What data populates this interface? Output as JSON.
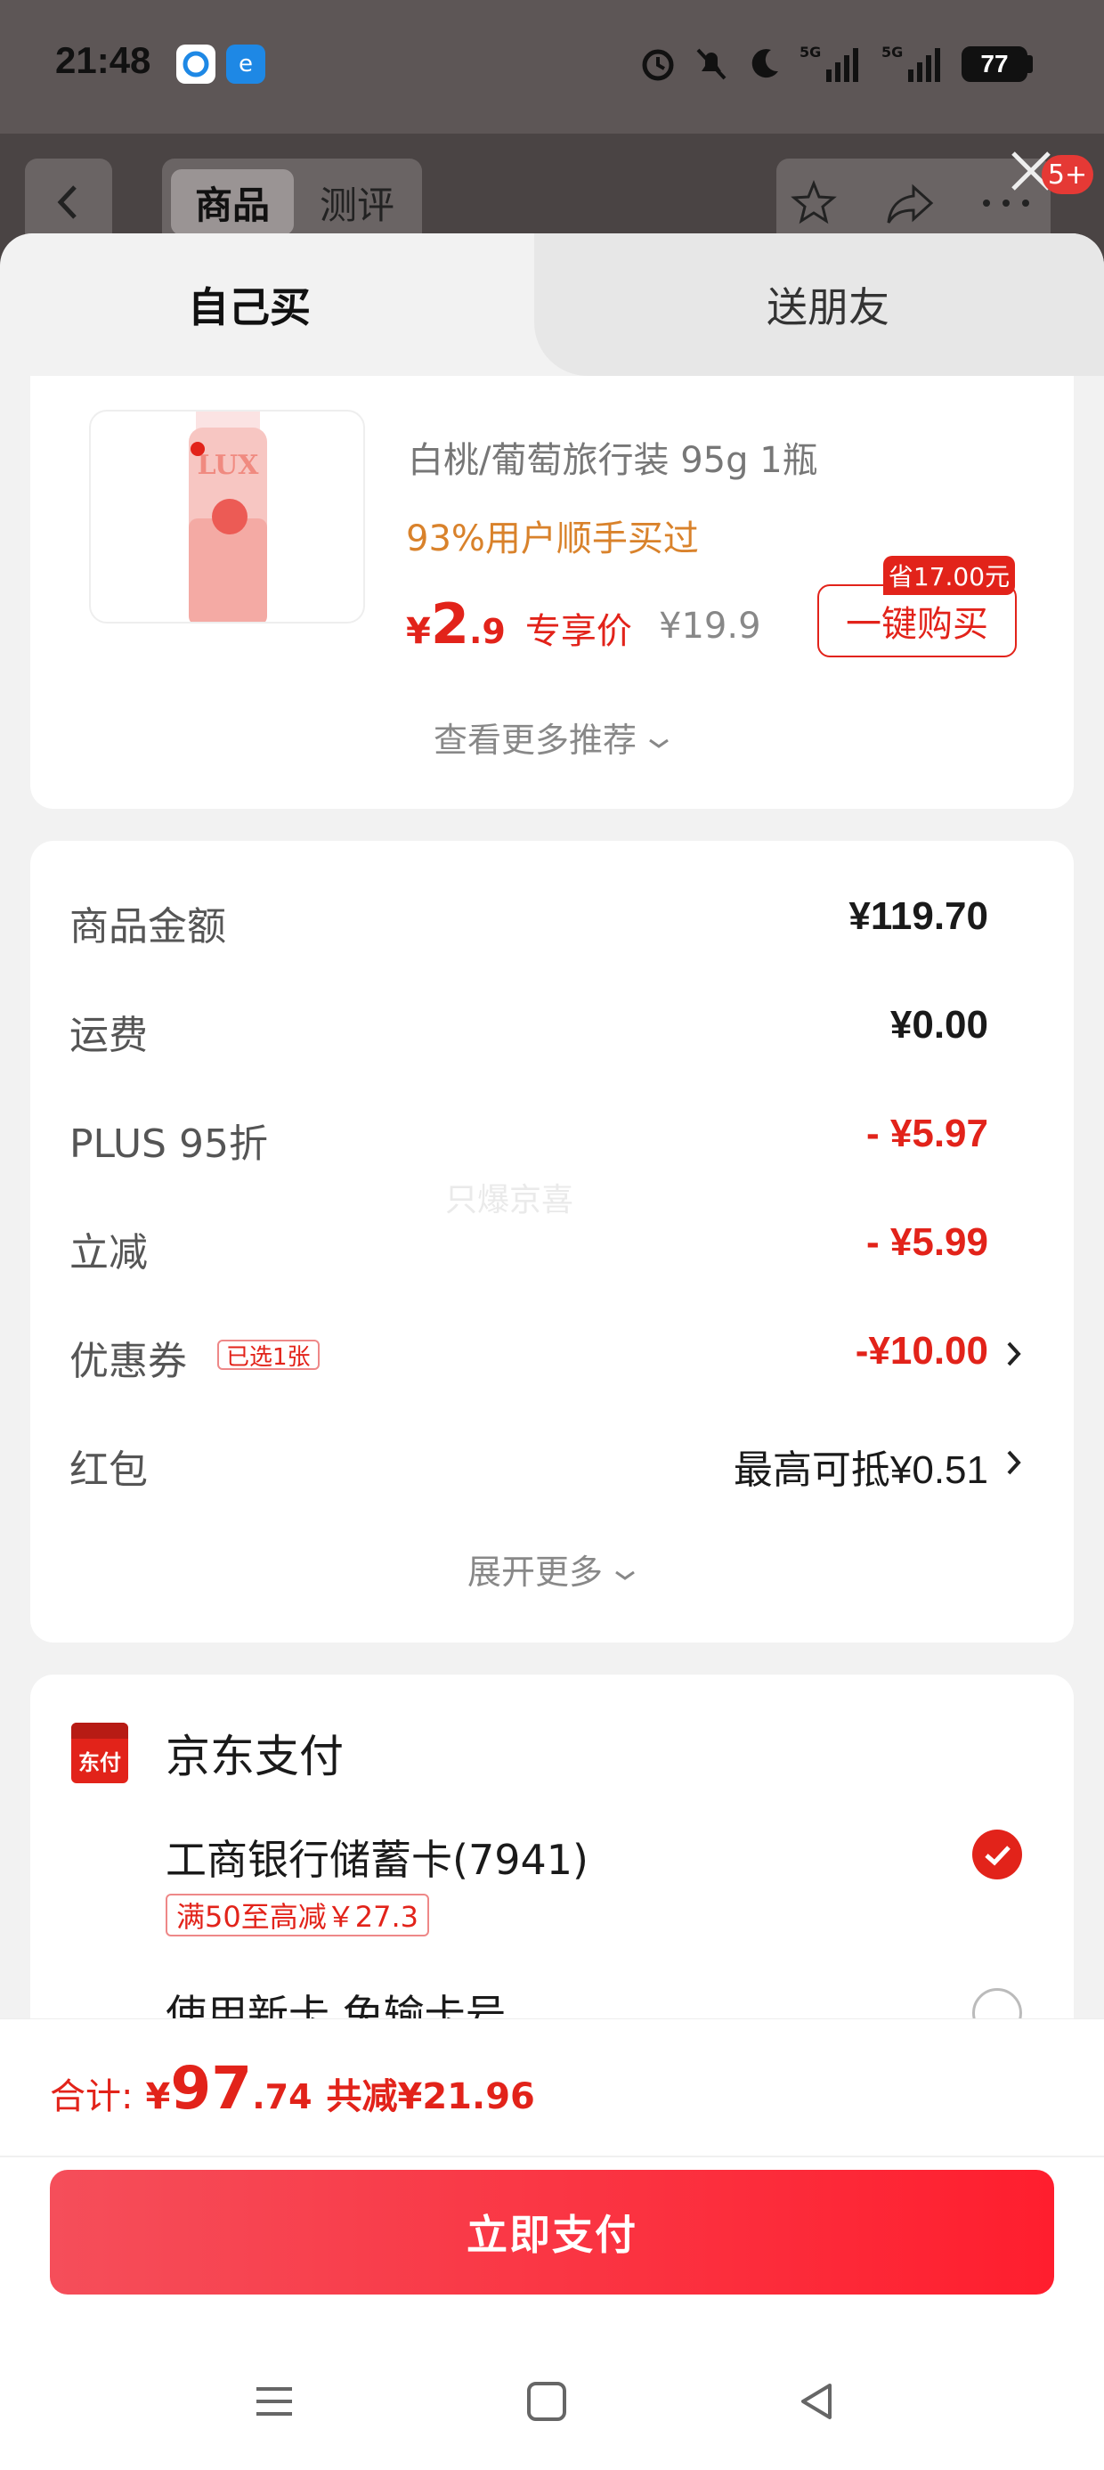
{
  "status_bar": {
    "time": "21:48",
    "battery": "77"
  },
  "header": {
    "tab_goods": "商品",
    "tab_review": "测评",
    "badge": "5+"
  },
  "sheet_tabs": {
    "self": "自己买",
    "gift": "送朋友"
  },
  "recommend": {
    "product_name": "白桃/葡萄旅行装 95g 1瓶",
    "bought_text": "93%用户顺手买过",
    "price_symbol": "¥",
    "price_int": "2",
    "price_dec": ".9",
    "price_tag": "专享价",
    "old_price": "¥19.9",
    "save_badge": "省17.00元",
    "buy_button": "一键购买",
    "more_link": "查看更多推荐"
  },
  "summary": {
    "rows": [
      {
        "label": "商品金额",
        "value": "¥119.70"
      },
      {
        "label": "运费",
        "value": "¥0.00"
      },
      {
        "label": "PLUS 95折",
        "value": "- ¥5.97"
      },
      {
        "label": "立减",
        "value": "- ¥5.99"
      },
      {
        "label": "优惠券",
        "value": "-¥10.00",
        "tag": "已选1张"
      },
      {
        "label": "红包",
        "value": "最高可抵¥0.51"
      }
    ],
    "expand": "展开更多",
    "watermark": "只爆京喜"
  },
  "payment": {
    "logo_text": "东付",
    "title": "京东支付",
    "bank": "工商银行储蓄卡(7941)",
    "bank_promo": "满50至高减￥27.3",
    "new_card": "使用新卡 免输卡号"
  },
  "footer": {
    "total_label": "合计:",
    "yen": "¥",
    "total_int": "97",
    "total_dec": ".74",
    "saved": "共减¥21.96",
    "pay_button": "立即支付"
  },
  "colors": {
    "accent": "#e2231a",
    "orange": "#d9822b",
    "button": "#ff1e2e"
  }
}
